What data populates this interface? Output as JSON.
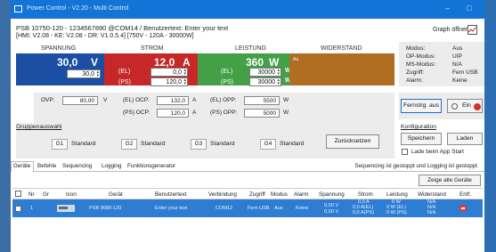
{
  "window": {
    "title": "Power Control - V2.20 - Multi Control",
    "device_line": "PSB 10750-120 - 1234567890 @COM14 / Benutzertext: Enter your text",
    "firmware_line": "[HMI: V2.08 - KE: V2.08 - DR: V1.0.5.4] [750V - 120A - 30000W]",
    "graph_open": "Graph öffnen"
  },
  "readings": {
    "voltage": {
      "header": "SPANNUNG",
      "actual": "30,0",
      "unit": "V",
      "set": "30,0"
    },
    "current": {
      "header": "STROM",
      "actual": "12,0",
      "unit": "A",
      "set_el": "0,0",
      "set_ps": "120,0",
      "el_label": "(EL)",
      "ps_label": "(PS)"
    },
    "power": {
      "header": "LEISTUNG",
      "actual": "360",
      "unit": "W",
      "set_el": "30000",
      "set_ps": "30000",
      "el_label": "(EL)",
      "ps_label": "(PS)"
    },
    "resistance": {
      "header": "WIDERSTAND",
      "note": "Aa"
    }
  },
  "status": [
    {
      "key": "Modus:",
      "value": "Aus"
    },
    {
      "key": "OP-Modus:",
      "value": "UIP"
    },
    {
      "key": "MS-Modus:",
      "value": "N/A"
    },
    {
      "key": "Zugriff:",
      "value": "Fern USB"
    },
    {
      "key": "Alarm:",
      "value": "Keine"
    }
  ],
  "protection": {
    "ovp_label": "OVP:",
    "ovp_value": "80,00",
    "ovp_unit": "V",
    "el_ocp_label": "(EL) OCP:",
    "el_ocp_value": "132,0",
    "el_ocp_unit": "A",
    "ps_ocp_label": "(PS) OCP:",
    "ps_ocp_value": "120,0",
    "ps_ocp_unit": "A",
    "el_opp_label": "(EL) OPP:",
    "el_opp_value": "5500",
    "el_opp_unit": "W",
    "ps_opp_label": "(PS) OPP:",
    "ps_opp_value": "5000",
    "ps_opp_unit": "W"
  },
  "remote": {
    "fernstrg": "Fernstrg. aus",
    "ein": "Ein"
  },
  "groups": {
    "title": "Gruppenauswahl",
    "items": [
      {
        "id": "G1",
        "name": "Standard"
      },
      {
        "id": "G2",
        "name": "Standard"
      },
      {
        "id": "G3",
        "name": "Standard"
      },
      {
        "id": "G4",
        "name": "Standard"
      }
    ],
    "reset": "Zurücksetzen"
  },
  "config": {
    "title": "Konfiguration",
    "save": "Speichern",
    "load": "Laden",
    "autoload": "Lade beim App Start"
  },
  "tabs": [
    "Geräte",
    "Befehle",
    "Sequencing",
    "Logging",
    "Funktionsgenerator"
  ],
  "seq_status": "Sequencing ist gestoppt und Logging ist gestoppt",
  "show_all": "Zeige alle Geräte",
  "table": {
    "headers": [
      "Nr",
      "Gr",
      "Icon",
      "Gerät",
      "Benutzertext",
      "Verbindung",
      "Zugriff",
      "Modus",
      "Alarm",
      "Spannung",
      "Strom",
      "Leistung",
      "Widerstand",
      "Entf."
    ],
    "row": {
      "nr": "1",
      "gr": "",
      "geraet": "PSB 9080-120",
      "benutzertext": "Enter your text",
      "verbindung": "COM12",
      "zugriff": "Fern USB",
      "modus": "Aus",
      "alarm": "Keine",
      "spannung1": "0,00 V",
      "spannung2": "0,00 V",
      "strom1": "0,0 A",
      "strom2": "0,0 A(EL)",
      "strom3": "0,0 A(PS)",
      "leistung1": "0 W",
      "leistung2": "0 W (EL)",
      "leistung3": "0 W (PS)",
      "widerstand1": "N/A",
      "widerstand2": "N/A",
      "widerstand3": "N/A"
    }
  },
  "colors": {
    "voltage": "#1b4fa3",
    "current": "#c62828",
    "power": "#43a047",
    "resistance": "#b06e22",
    "titlebar": "#1174d6",
    "row_selected": "#2f7dd3"
  }
}
